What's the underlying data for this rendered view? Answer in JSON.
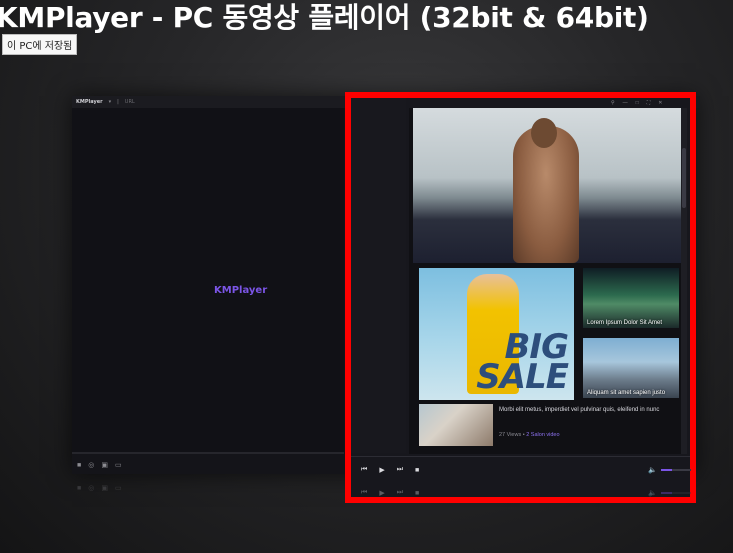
{
  "page_title": "KMPlayer - PC 동영상 플레이어 (32bit & 64bit)",
  "save_tooltip": "이 PC에 저장됨",
  "app": {
    "topbar_app_name": "KMPlayer",
    "topbar_url_label": "URL",
    "logo_text": "KMPlayer",
    "left_controls_icons": [
      "stop-icon",
      "repeat-icon",
      "capture-icon",
      "vr-icon"
    ]
  },
  "panel": {
    "side_cards": [
      {
        "caption": "Lorem Ipsum Dolor Sit Amet"
      },
      {
        "caption": "Aliquam sit amet sapien justo"
      }
    ],
    "promo_text": {
      "line1": "BIG",
      "line2": "SALE"
    },
    "article": {
      "title": "Morbi elit metus, imperdiet vel pulvinar quis, eleifend in nunc",
      "views": "27 Views",
      "separator": "•",
      "channel": "2 Salon video"
    },
    "control_icons": [
      "prev-icon",
      "play-icon",
      "next-icon",
      "stop-icon",
      "volume-icon"
    ],
    "volume_level": 0.35
  },
  "colors": {
    "accent_purple": "#7b55e6",
    "highlight_red": "#ff0000"
  }
}
